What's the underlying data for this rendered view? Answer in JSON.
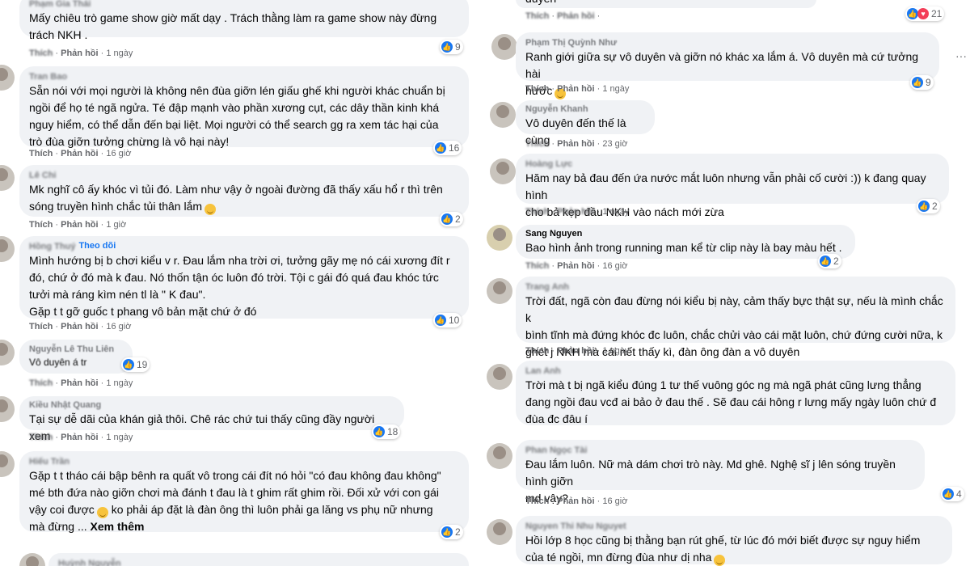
{
  "actions": {
    "like": "Thích",
    "reply": "Phản hồi"
  },
  "left": {
    "c0": {
      "name": "Phạm Gia Thái",
      "text": "Mấy chiêu trò game show giờ mất dạy . Trách thằng làm ra game show này đừng\ntrách NKH .",
      "time": "1 ngày",
      "reactions": "9"
    },
    "c1": {
      "name": "Tran Bao",
      "text": "Sẵn nói với mọi người là không nên đùa giỡn lén giấu ghế khi người khác chuẩn bị\nngồi để họ té ngã ngửa. Té đập mạnh vào phần xương cụt, các dây thần kinh khá\nnguy hiểm, có thể dẫn đến bại liệt. Mọi người có thể search gg ra xem tác hại của\ntrò đùa giỡn tưởng chừng là vô hại này!",
      "time": "16 giờ",
      "reactions": "16"
    },
    "c2": {
      "name": "Lê Chi",
      "text": "Mk nghĩ cô ấy khóc vì tủi đó. Làm như vậy ở ngoài đường đã thấy xấu hổ r thì trên\nsóng truyền hình chắc tủi thân lắm",
      "time": "1 giờ",
      "reactions": "2"
    },
    "c3": {
      "name": "Hồng Thuý",
      "follow": "Theo dõi",
      "text": "Mình hướng bị b chơi kiểu v r. Đau lắm nha trời ơi, tưởng gãy mẹ nó cái xương đít r\nđó, chứ ở đó mà k đau. Nó thốn tận óc luôn đó trời. Tội c gái đó quá đau khóc tức\ntưởi mà ráng kìm nén tl là \" K đau\".\nGặp t t gỡ guốc t phang vô bản mặt chứ ở đó",
      "time": "16 giờ",
      "reactions": "10"
    },
    "c4": {
      "name": "Nguyễn Lê Thu Liên",
      "text": "Vô duyên á tr",
      "time": "1 ngày",
      "reactions": "19"
    },
    "c5": {
      "name": "Kiều Nhật Quang",
      "text": "Tại sự dễ dãi của khán giả thôi. Chê rác chứ tui thấy cũng đầy người xem",
      "time": "1 ngày",
      "reactions": "18"
    },
    "c6": {
      "name": "Hiếu Trần",
      "text": "Gặp t t tháo cái bập bênh ra quất vô trong cái đít nó hỏi \"có đau không đau không\"\nmé bth đứa nào giỡn chơi mà đánh t đau là t ghim rất ghim rồi. Đối xử với con gái\nvậy coi được",
      "text2": " ko phải áp đặt là đàn ông thì luôn phải ga lăng vs phụ nữ nhưng\nmà đừng ... ",
      "more": "Xem thêm",
      "reactions": "2"
    },
    "c7": {
      "name": "Huỳnh Nguyễn"
    }
  },
  "right": {
    "c0": {
      "text": "duyên",
      "time": "",
      "reactions": "21"
    },
    "c1": {
      "name": "Phạm Thị Quỳnh Như",
      "text": "Ranh giới giữa sự vô duyên và giỡn nó khác xa lắm á. Vô duyên mà cứ tưởng hài\nhước",
      "time": "1 ngày",
      "reactions": "9"
    },
    "c2": {
      "name": "Nguyễn Khanh",
      "text": "Vô duyên đến thế là cùng",
      "time": "23 giờ"
    },
    "c3": {
      "name": "Hoàng Lực",
      "text": "Hăm nay bả đau đến ứa nước mắt luôn nhưng vẫn phải cố cười :)) k đang quay hình\ncho bả kẹp đầu NKH vào nách mới zừa",
      "time": "1 ngày",
      "reactions": "2"
    },
    "c4": {
      "name": "Sang Nguyen",
      "text": "Bao hình ảnh trong running man kể từ clip này là bay màu hết .",
      "time": "16 giờ",
      "reactions": "2"
    },
    "c5": {
      "name": "Trang Anh",
      "text": "Trời đất, ngã còn đau đừng nói kiểu bị này, cảm thấy bực thật sự, nếu là mình chắc k\nbình tĩnh mà đứng khóc đc luôn, chắc chửi vào cái mặt luôn, chứ đứng cười nữa, k\nghét j NKH mà cái nết thấy kì, đàn ông đàn a vô duyên",
      "time": "1 ngày"
    },
    "c6": {
      "name": "Lan Anh",
      "text": "Trời mà t bị ngã kiểu đúng 1 tư thế vuông góc ng mà ngã phát cũng lưng thẳng\nđang ngồi đau vcđ ai bảo ở đau thế . Sẽ đau cái hông r lưng mấy ngày luôn chứ đ\nđùa đc đâu í",
      "time": ""
    },
    "c7": {
      "name": "Phan Ngọc Tài",
      "text": "Đau lắm luôn. Nữ mà dám chơi trò này. Md ghê. Nghệ sĩ j lên sóng truyền hình giỡn\nmd vậy?",
      "time": "16 giờ",
      "reactions": "4"
    },
    "c8": {
      "name": "Nguyen Thi Nhu Nguyet",
      "text": "Hồi lớp 8 học cũng bị thằng bạn rút ghế, từ lúc đó mới biết được sự nguy hiểm\ncủa té ngồi, mn đừng đùa như dị nha"
    }
  }
}
